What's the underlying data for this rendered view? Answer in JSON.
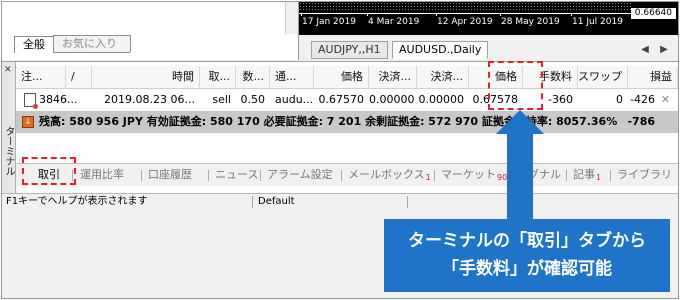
{
  "navigator": {
    "tabs": [
      {
        "label": "全般"
      },
      {
        "label": "お気に入り"
      }
    ]
  },
  "chart": {
    "dates": [
      "17 Jan 2019",
      "4 Mar 2019",
      "12 Apr 2019",
      "28 May 2019",
      "11 Jul 2019"
    ],
    "price_label": "0.66640",
    "tabs": [
      {
        "label": "AUDJPY,,H1"
      },
      {
        "label": "AUDUSD.,Daily"
      }
    ],
    "scroll_left": "◀",
    "scroll_right": "▶"
  },
  "terminal": {
    "side_close": "✕",
    "side_label": "ターミナル",
    "columns": [
      "注...",
      "/",
      "時間",
      "取...",
      "数...",
      "通...",
      "価格",
      "決済...",
      "決済...",
      "価格",
      "手数料",
      "スワップ",
      "損益"
    ],
    "rows": [
      [
        "3846...",
        "",
        "2019.08.23 06...",
        "sell",
        "0.50",
        "audu...",
        "0.67570",
        "0.00000",
        "0.00000",
        "0.67578",
        "-360",
        "0",
        "-426"
      ]
    ],
    "row_close": "✕",
    "summary": {
      "icon": "↓",
      "text": "残高: 580 956 JPY  有効証拠金: 580 170  必要証拠金: 7 201  余剰証拠金: 572 970  証拠金維持率: 8057.36%",
      "value": "-786"
    },
    "tabs": [
      {
        "label": "取引"
      },
      {
        "label": "運用比率"
      },
      {
        "label": "口座履歴"
      },
      {
        "label": "ニュース"
      },
      {
        "label": "アラーム設定"
      },
      {
        "label": "メールボックス",
        "badge": "1"
      },
      {
        "label": "マーケット",
        "badge": "90"
      },
      {
        "label": "シグナル"
      },
      {
        "label": "記事",
        "badge": "1"
      },
      {
        "label": "ライブラリ"
      }
    ]
  },
  "status_bar": {
    "help": "F1キーでヘルプが表示されます",
    "profile": "Default"
  },
  "callout": {
    "line1": "ターミナルの「取引」タブから",
    "line2": "「手数料」が確認可能"
  },
  "colors": {
    "highlight": "#e8202c",
    "callout_bg": "#1f73c9",
    "summary_icon": "#e46a1c"
  }
}
